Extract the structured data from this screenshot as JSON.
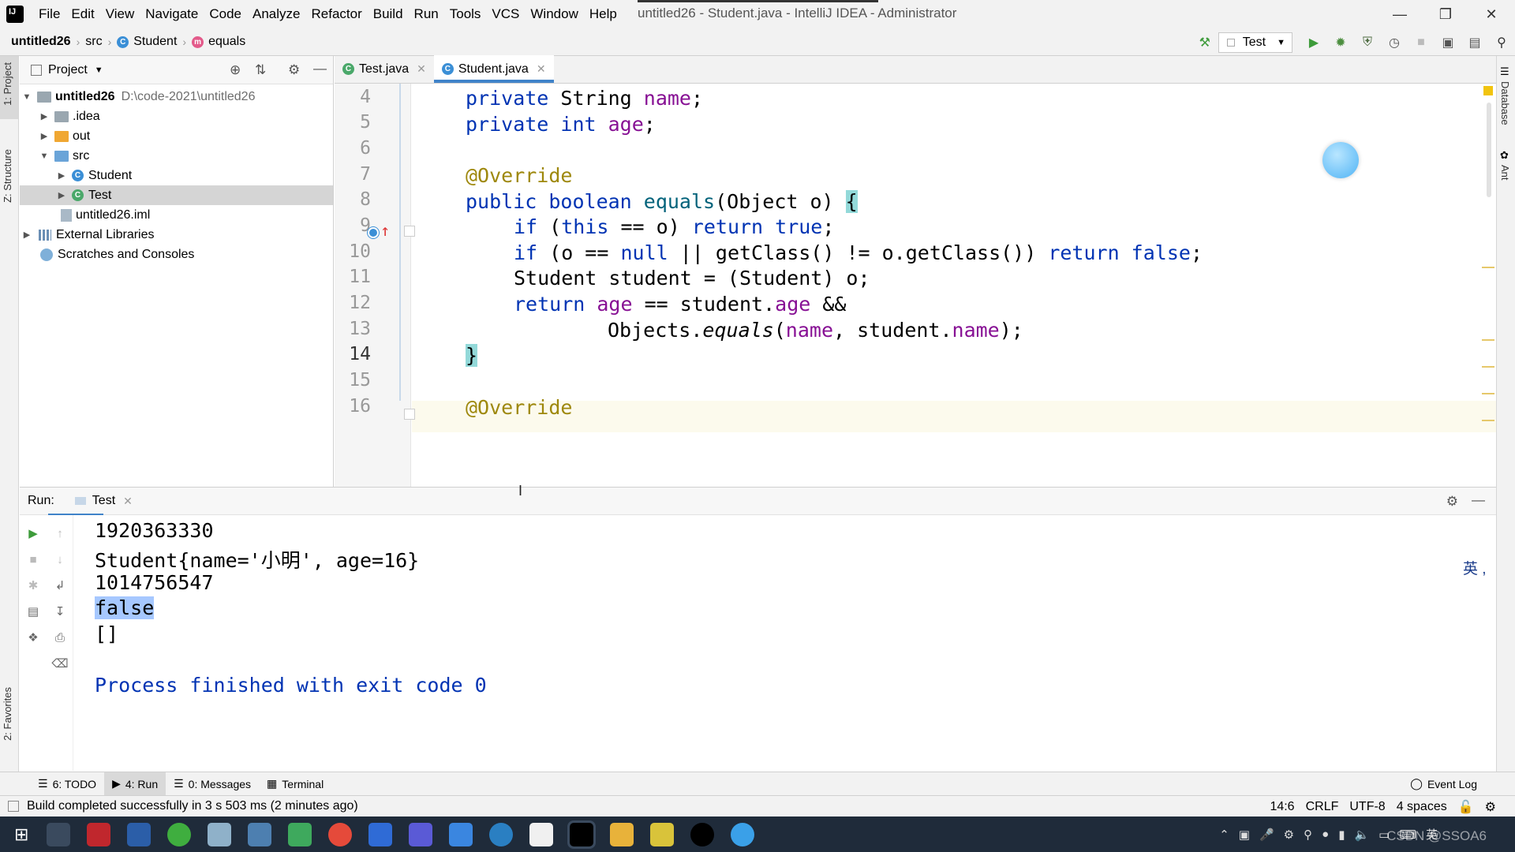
{
  "menubar": {
    "items": [
      "File",
      "Edit",
      "View",
      "Navigate",
      "Code",
      "Analyze",
      "Refactor",
      "Build",
      "Run",
      "Tools",
      "VCS",
      "Window",
      "Help"
    ],
    "window_title": "untitled26 - Student.java - IntelliJ IDEA - Administrator"
  },
  "breadcrumb": {
    "project": "untitled26",
    "folder": "src",
    "class": "Student",
    "method": "equals"
  },
  "toolbar": {
    "run_config": "Test"
  },
  "left_strip": {
    "project_tab": "1: Project",
    "structure_tab": "Z: Structure",
    "favorites_tab": "2: Favorites"
  },
  "right_strip": {
    "database_tab": "Database",
    "ant_tab": "Ant"
  },
  "project_panel": {
    "title": "Project",
    "tree": {
      "root": "untitled26",
      "root_path": "D:\\code-2021\\untitled26",
      "idea": ".idea",
      "out": "out",
      "src": "src",
      "student": "Student",
      "test": "Test",
      "iml": "untitled26.iml",
      "external": "External Libraries",
      "scratches": "Scratches and Consoles"
    }
  },
  "editor": {
    "tabs": [
      "Test.java",
      "Student.java"
    ],
    "active_tab": "Student.java",
    "line_numbers": [
      "4",
      "5",
      "6",
      "7",
      "8",
      "9",
      "10",
      "11",
      "12",
      "13",
      "14",
      "15",
      "16"
    ],
    "lines": {
      "l4_a": "private ",
      "l4_b": "String ",
      "l4_c": "name",
      "l4_d": ";",
      "l5_a": "private int ",
      "l5_c": "age",
      "l5_d": ";",
      "l7": "@Override",
      "l8_a": "public boolean ",
      "l8_b": "equals",
      "l8_c": "(Object o) ",
      "l8_d": "{",
      "l9_a": "if ",
      "l9_b": "(",
      "l9_c": "this",
      "l9_d": " == o) ",
      "l9_e": "return true",
      "l9_f": ";",
      "l10_a": "if ",
      "l10_b": "(o == ",
      "l10_c": "null",
      "l10_d": " || getClass() != o.getClass()) ",
      "l10_e": "return false",
      "l10_f": ";",
      "l11": "Student student = (Student) o;",
      "l12_a": "return ",
      "l12_b": "age",
      "l12_c": " == student.",
      "l12_d": "age",
      "l12_e": " &&",
      "l13_a": "Objects.",
      "l13_b": "equals",
      "l13_c": "(",
      "l13_d": "name",
      "l13_e": ", student.",
      "l13_f": "name",
      "l13_g": ");",
      "l14": "}",
      "l16": "@Override"
    }
  },
  "run_panel": {
    "label": "Run:",
    "tab": "Test",
    "output": [
      "1920363330",
      "Student{name='小明', age=16}",
      "1014756547",
      "false",
      "[]"
    ],
    "process_finished": "Process finished with exit code 0"
  },
  "tool_tabs": {
    "todo": "6: TODO",
    "run": "4: Run",
    "messages": "0: Messages",
    "terminal": "Terminal",
    "event_log": "Event Log"
  },
  "statusbar": {
    "message": "Build completed successfully in 3 s 503 ms (2 minutes ago)",
    "position": "14:6",
    "line_sep": "CRLF",
    "encoding": "UTF-8",
    "indent": "4 spaces"
  },
  "ime": "英 ,",
  "taskbar": {
    "watermark": "CSDN @SSOA6",
    "tray_lang": "英"
  }
}
